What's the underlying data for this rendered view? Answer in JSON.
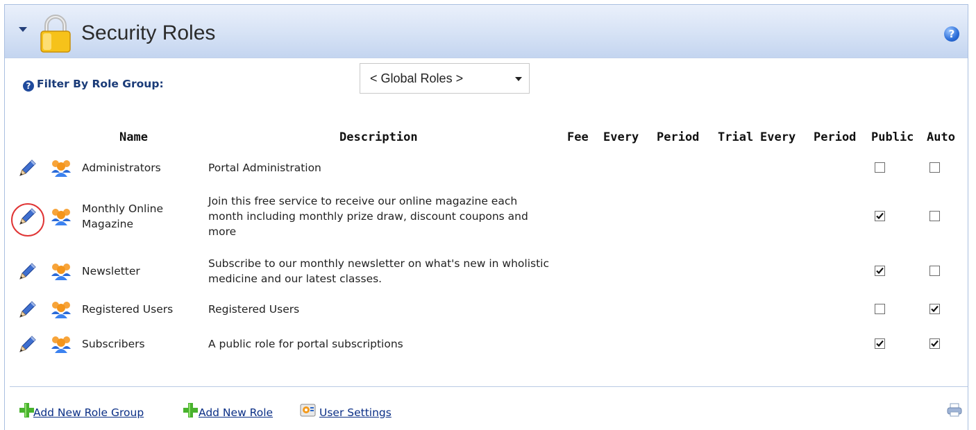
{
  "header": {
    "title": "Security Roles"
  },
  "filter": {
    "label": "Filter By Role Group:",
    "selected": "< Global Roles >"
  },
  "table": {
    "columns": [
      "Name",
      "Description",
      "Fee",
      "Every",
      "Period",
      "Trial",
      "Every",
      "Period",
      "Public",
      "Auto"
    ],
    "rows": [
      {
        "name": "Administrators",
        "description": "Portal Administration",
        "public": false,
        "auto": false
      },
      {
        "name": "Monthly Online Magazine",
        "description": "Join this free service to receive our online magazine each month including monthly prize draw, discount coupons and more",
        "public": true,
        "auto": false
      },
      {
        "name": "Newsletter",
        "description": "Subscribe to our monthly newsletter on what's new in wholistic medicine and our latest classes.",
        "public": true,
        "auto": false
      },
      {
        "name": "Registered Users",
        "description": "Registered Users",
        "public": false,
        "auto": true
      },
      {
        "name": "Subscribers",
        "description": "A public role for portal subscriptions",
        "public": true,
        "auto": true
      }
    ]
  },
  "footer": {
    "add_role_group": "Add New Role Group",
    "add_role": "Add New Role",
    "user_settings": "User Settings"
  },
  "icons": {
    "collapse": "triangle-down-icon",
    "lock": "padlock-icon",
    "help": "help-icon",
    "edit": "pencil-icon",
    "group": "users-group-icon",
    "add": "green-plus-icon",
    "settings": "user-settings-icon",
    "print": "print-icon"
  },
  "colors": {
    "header_gradient_top": "#eaf0fb",
    "header_gradient_bottom": "#c4d5f0",
    "link": "#0b2f86",
    "label": "#1a3b78",
    "highlight_circle": "#e03535"
  }
}
